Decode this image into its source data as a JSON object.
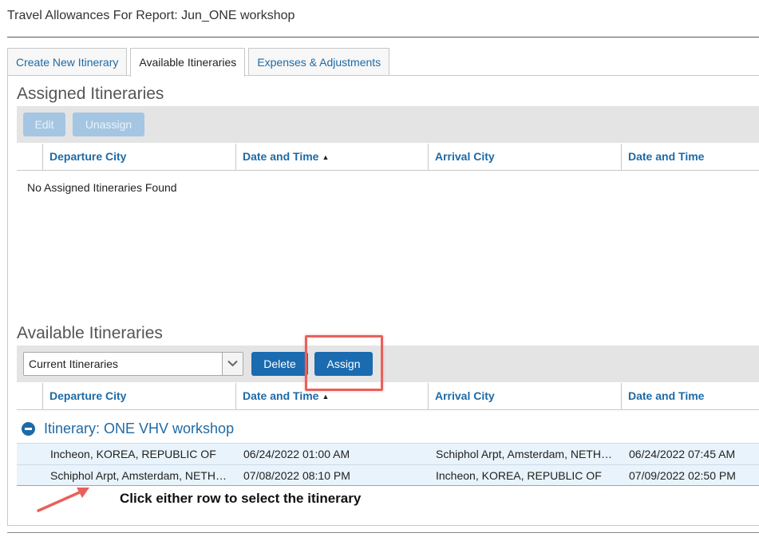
{
  "page": {
    "title": "Travel Allowances For Report: Jun_ONE workshop"
  },
  "tabs": [
    {
      "label": "Create New Itinerary",
      "active": false
    },
    {
      "label": "Available Itineraries",
      "active": true
    },
    {
      "label": "Expenses & Adjustments",
      "active": false
    }
  ],
  "assigned": {
    "title": "Assigned Itineraries",
    "edit_label": "Edit",
    "unassign_label": "Unassign",
    "columns": [
      "Departure City",
      "Date and Time",
      "Arrival City",
      "Date and Time"
    ],
    "sorted_column_index": 1,
    "sort_direction": "ascending",
    "empty_message": "No Assigned Itineraries Found"
  },
  "available": {
    "title": "Available Itineraries",
    "filter_selected": "Current Itineraries",
    "delete_label": "Delete",
    "assign_label": "Assign",
    "columns": [
      "Departure City",
      "Date and Time",
      "Arrival City",
      "Date and Time"
    ],
    "sorted_column_index": 1,
    "sort_direction": "ascending",
    "group_label": "Itinerary: ONE VHV workshop",
    "rows": [
      {
        "departure_city": "Incheon, KOREA, REPUBLIC OF",
        "departure_time": "06/24/2022 01:00 AM",
        "arrival_city": "Schiphol Arpt, Amsterdam, NETHERLANDS",
        "arrival_time": "06/24/2022 07:45 AM"
      },
      {
        "departure_city": "Schiphol Arpt, Amsterdam, NETHERLANDS",
        "departure_time": "07/08/2022 08:10 PM",
        "arrival_city": "Incheon, KOREA, REPUBLIC OF",
        "arrival_time": "07/09/2022 02:50 PM"
      }
    ]
  },
  "annotation": {
    "text": "Click either row to select the itinerary"
  },
  "colors": {
    "accent": "#1a6bb0",
    "link": "#1e6aa6",
    "highlight": "#e9605a",
    "row_bg": "#e8f3fb"
  }
}
